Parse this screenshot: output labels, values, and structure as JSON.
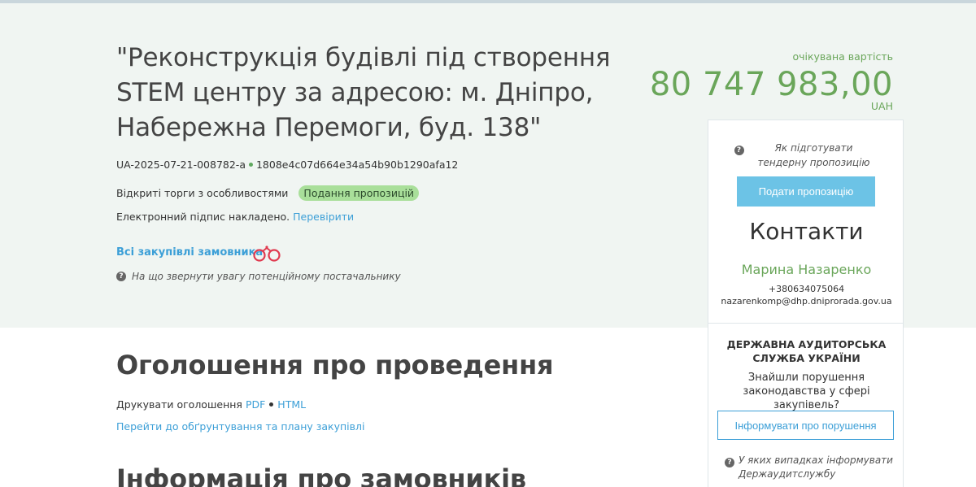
{
  "tender": {
    "title": "\"Реконструкція будівлі під створення STEM центру за адресою: м. Дніпро, Набережна Перемоги, буд. 138\"",
    "id": "UA-2025-07-21-008782-a",
    "hash": "1808e4c07d664e34a54b90b1290afa12",
    "procedure": "Відкриті торги з особливостями",
    "status": "Подання пропозицій",
    "signature_text": "Електронний підпис накладено.",
    "signature_link": "Перевірити",
    "buyer_link": "Всі закупівлі замовника",
    "supplier_hint": "На що звернути увагу потенційному постачальнику"
  },
  "cost": {
    "label": "очікувана вартість",
    "amount": "80 747 983,00",
    "currency": "UAH"
  },
  "panel": {
    "how_to": "Як підготувати тендерну пропозицію",
    "submit_label": "Подати пропозицію",
    "contacts_title": "Контакти",
    "contact_name": "Марина Назаренко",
    "contact_phone": "+380634075064",
    "contact_email": "nazarenkomp@dhp.dniprorada.gov.ua",
    "audit_title_1": "ДЕРЖАВНА АУДИТОРСЬКА",
    "audit_title_2": "СЛУЖБА УКРАЇНИ",
    "audit_question_1": "Знайшли порушення",
    "audit_question_2": "законодавства у сфері закупівель?",
    "report_label": "Інформувати про порушення",
    "audit_hint_1": "У яких випадках інформувати",
    "audit_hint_2": "Держаудитслужбу"
  },
  "announcement": {
    "title": "Оголошення про проведення",
    "print_label": "Друкувати оголошення",
    "pdf_link": "PDF",
    "html_link": "HTML",
    "plan_link": "Перейти до обґрунтування та плану закупівлі"
  },
  "buyers_section": {
    "title": "Інформація про замовників"
  }
}
